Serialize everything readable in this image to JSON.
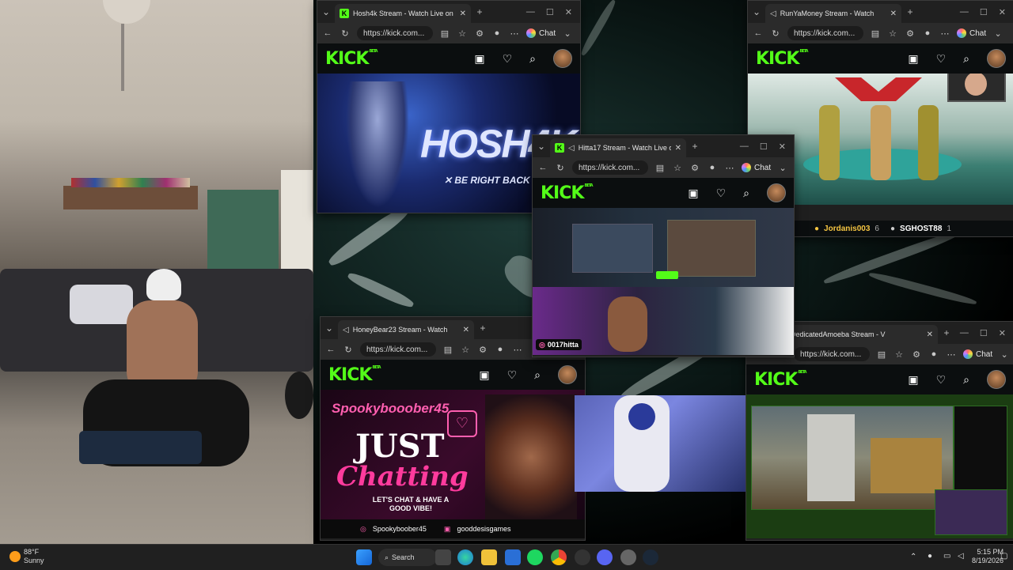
{
  "windows": {
    "hosh": {
      "tab_title": "Hosh4k Stream - Watch Live on Ki",
      "url": "https://kick.com...",
      "chat_label": "Chat",
      "brand": "KICK",
      "beta": "BETA",
      "banner_text": "HOSH4K",
      "banner_sub": "✕ BE RIGHT BACK"
    },
    "runya": {
      "tab_title": "RunYaMoney Stream - Watch",
      "url": "https://kick.com...",
      "chat_label": "Chat",
      "brand": "KICK",
      "beta": "BETA",
      "gifter1_name": "Jordanis003",
      "gifter1_count": "6",
      "gifter2_name": "SGHOST88",
      "gifter2_count": "1"
    },
    "hitta": {
      "tab_title": "Hitta17 Stream - Watch Live o",
      "url": "https://kick.com...",
      "chat_label": "Chat",
      "brand": "KICK",
      "beta": "BETA",
      "overlay_handle": "0017hitta"
    },
    "honey": {
      "tab_title": "HoneyBear23 Stream - Watch",
      "url": "https://kick.com...",
      "brand": "KICK",
      "beta": "BETA",
      "panel_name": "Spookybooober45",
      "panel_big1": "JUST",
      "panel_big2": "Chatting",
      "panel_sub": "LET'S CHAT & HAVE A GOOD VIBE!",
      "social1": "Spookyboober45",
      "social2": "gooddesisgames"
    },
    "amoeba": {
      "tab_title": "DedicatedAmoeba Stream - V",
      "url": "https://kick.com...",
      "chat_label": "Chat",
      "brand": "KICK",
      "beta": "BETA"
    }
  },
  "taskbar": {
    "weather_temp": "88°F",
    "weather_desc": "Sunny",
    "search_label": "Search",
    "time": "5:15 PM",
    "date": "8/19/2026"
  },
  "colors": {
    "kick_green": "#53fc18",
    "window_bg": "#1f1f1f",
    "taskbar_bg": "#202020"
  }
}
